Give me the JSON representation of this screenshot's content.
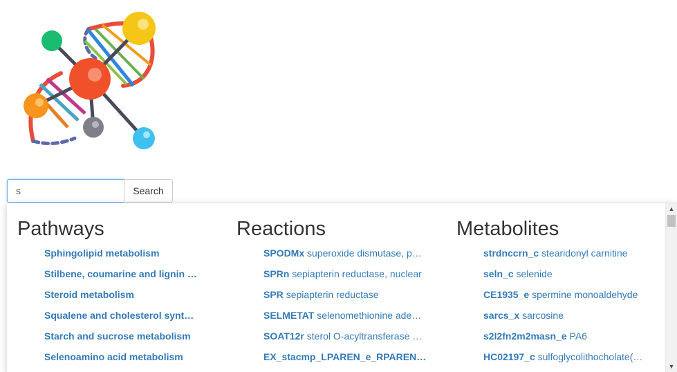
{
  "search": {
    "value": "s",
    "button_label": "Search"
  },
  "dropdown": {
    "pathways": {
      "heading": "Pathways",
      "items": [
        {
          "name": "Sphingolipid metabolism"
        },
        {
          "name": "Stilbene, coumarine and lignin …"
        },
        {
          "name": "Steroid metabolism"
        },
        {
          "name": "Squalene and cholesterol synt…"
        },
        {
          "name": "Starch and sucrose metabolism"
        },
        {
          "name": "Selenoamino acid metabolism"
        }
      ]
    },
    "reactions": {
      "heading": "Reactions",
      "items": [
        {
          "id": "SPODMx",
          "desc": "superoxide dismutase, p…"
        },
        {
          "id": "SPRn",
          "desc": "sepiapterin reductase, nuclear"
        },
        {
          "id": "SPR",
          "desc": "sepiapterin reductase"
        },
        {
          "id": "SELMETAT",
          "desc": "selenomethionine ade…"
        },
        {
          "id": "SOAT12r",
          "desc": "sterol O-acyltransferase …"
        },
        {
          "id": "EX_stacmp_LPAREN_e_RPAREN…",
          "desc": ""
        }
      ]
    },
    "metabolites": {
      "heading": "Metabolites",
      "items": [
        {
          "id": "strdnccrn_c",
          "desc": "stearidonyl carnitine"
        },
        {
          "id": "seln_c",
          "desc": "selenide"
        },
        {
          "id": "CE1935_e",
          "desc": "spermine monoaldehyde"
        },
        {
          "id": "sarcs_x",
          "desc": "sarcosine"
        },
        {
          "id": "s2l2fn2m2masn_e",
          "desc": "PA6"
        },
        {
          "id": "HC02197_c",
          "desc": "sulfoglycolithocholate(…"
        }
      ]
    }
  },
  "scrollbar": {
    "up_icon": "▲",
    "down_icon": "▼"
  }
}
